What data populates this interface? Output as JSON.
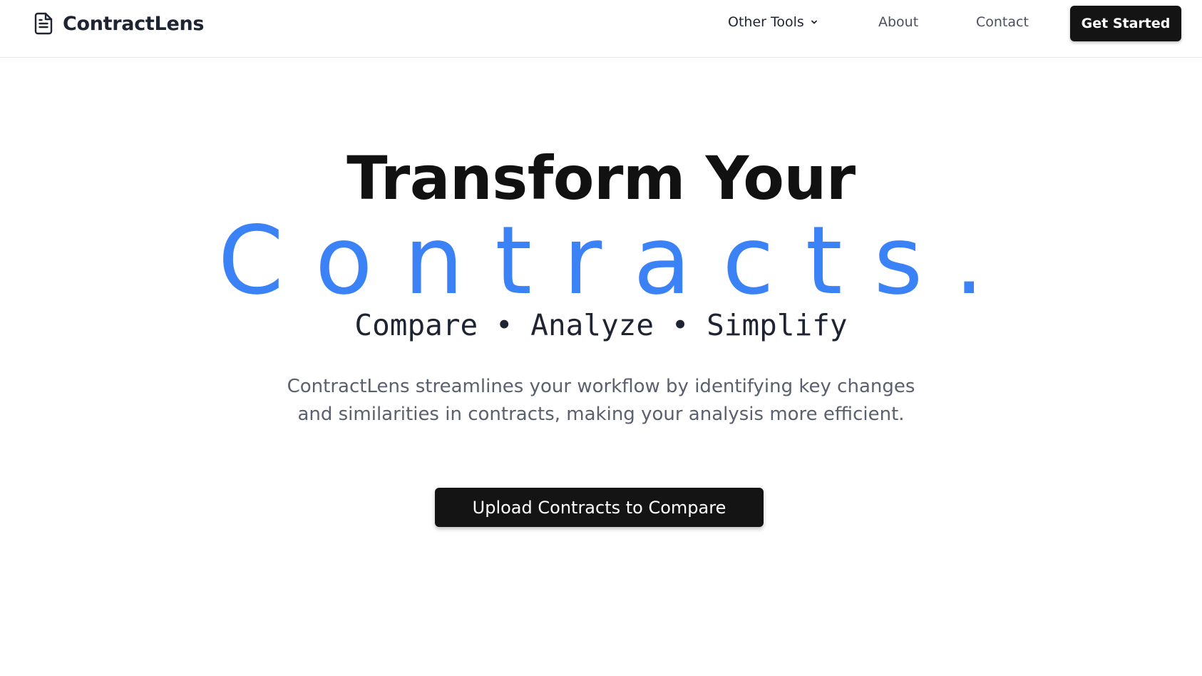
{
  "header": {
    "brand_name": "ContractLens",
    "brand_icon": "document-icon",
    "nav": {
      "other_tools": "Other Tools",
      "about": "About",
      "contact": "Contact"
    },
    "get_started": "Get Started"
  },
  "hero": {
    "title": "Transform Your",
    "accent": "Contracts.",
    "tagline": "Compare • Analyze • Simplify",
    "description": "ContractLens streamlines your workflow by identifying key changes and similarities in contracts, making your analysis more efficient.",
    "cta": "Upload Contracts to Compare"
  },
  "colors": {
    "accent": "#3b82f6",
    "button_bg": "#141414",
    "text_dark": "#1f2433",
    "text_muted": "#5b606e"
  }
}
